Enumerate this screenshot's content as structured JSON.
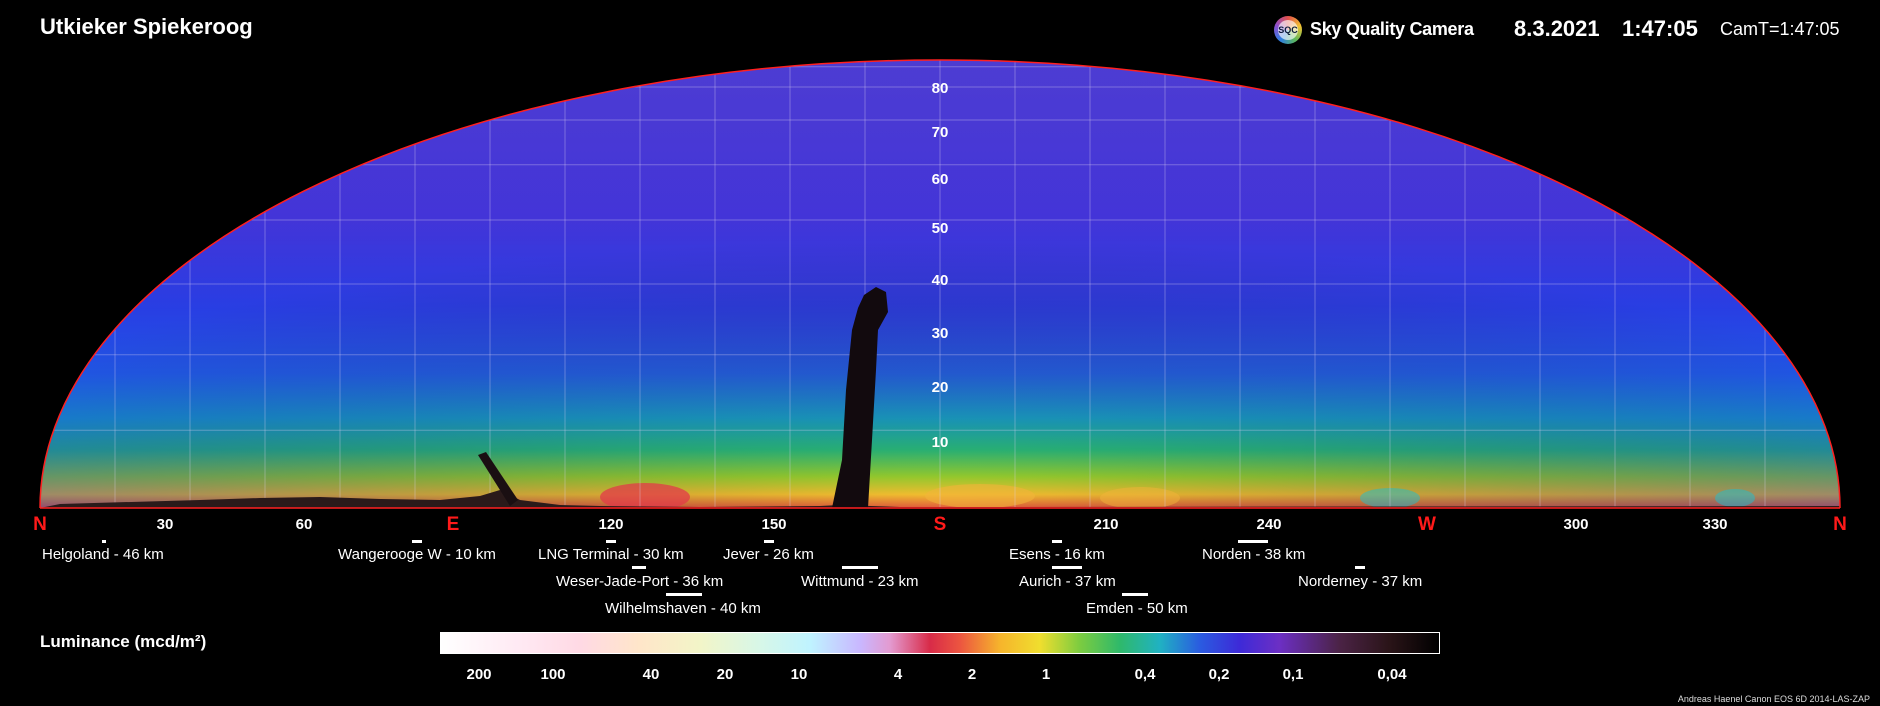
{
  "header": {
    "title": "Utkieker Spiekeroog",
    "logo_text": "SQC",
    "brand": "Sky Quality Camera",
    "date": "8.3.2021",
    "time": "1:47:05",
    "camera_time": "CamT=1:47:05"
  },
  "sky": {
    "cardinals": {
      "n_left": "N",
      "e": "E",
      "s": "S",
      "w": "W",
      "n_right": "N"
    },
    "azimuths": [
      "30",
      "60",
      "120",
      "150",
      "210",
      "240",
      "300",
      "330"
    ],
    "altitudes": [
      "80",
      "70",
      "60",
      "50",
      "40",
      "30",
      "20",
      "10"
    ]
  },
  "locations": [
    "Helgoland - 46 km",
    "Wangerooge W - 10 km",
    "LNG Terminal - 30 km",
    "Jever - 26 km",
    "Esens - 16 km",
    "Norden - 38 km",
    "Weser-Jade-Port - 36 km",
    "Wittmund - 23 km",
    "Aurich - 37 km",
    "Norderney - 37 km",
    "Wilhelmshaven - 40 km",
    "Emden - 50 km"
  ],
  "legend": {
    "title": "Luminance (mcd/m²)",
    "scale_labels": [
      "200",
      "100",
      "40",
      "20",
      "10",
      "4",
      "2",
      "1",
      "0,4",
      "0,2",
      "0,1",
      "0,04"
    ]
  },
  "credits": "Andreas Haenel    Canon EOS 6D    2014-LAS-ZAP"
}
